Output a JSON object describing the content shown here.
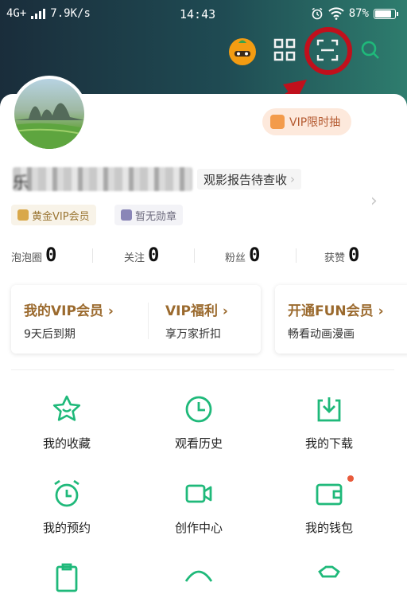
{
  "status_bar": {
    "network": "4G+",
    "speed": "7.9K/s",
    "time": "14:43",
    "battery": "87%",
    "battery_level": 0.87
  },
  "header": {
    "icons": [
      "mascot-icon",
      "qr-code-icon",
      "scan-icon",
      "search-icon"
    ],
    "accent_color": "#1fb97a",
    "highlight_color": "#c0101c"
  },
  "profile": {
    "username_visible": "乐",
    "vip_promo": "VIP限时抽",
    "report_link": "观影报告待查收",
    "badges": [
      {
        "label": "黄金VIP会员",
        "icon": "crown-icon"
      },
      {
        "label": "暂无勋章",
        "icon": "medal-icon"
      }
    ],
    "stats": [
      {
        "label": "泡泡圈",
        "value": "0"
      },
      {
        "label": "关注",
        "value": "0"
      },
      {
        "label": "粉丝",
        "value": "0"
      },
      {
        "label": "获赞",
        "value": "0"
      }
    ]
  },
  "vip_cards": [
    {
      "title": "我的VIP会员",
      "sub": "9天后到期"
    },
    {
      "title": "VIP福利",
      "sub": "享万家折扣"
    },
    {
      "title": "开通FUN会员",
      "sub": "畅看动画漫画"
    }
  ],
  "grid": [
    {
      "label": "我的收藏",
      "icon": "star-icon"
    },
    {
      "label": "观看历史",
      "icon": "clock-icon"
    },
    {
      "label": "我的下载",
      "icon": "download-icon"
    },
    {
      "label": "我的预约",
      "icon": "alarm-icon"
    },
    {
      "label": "创作中心",
      "icon": "video-camera-icon"
    },
    {
      "label": "我的钱包",
      "icon": "wallet-icon"
    }
  ]
}
